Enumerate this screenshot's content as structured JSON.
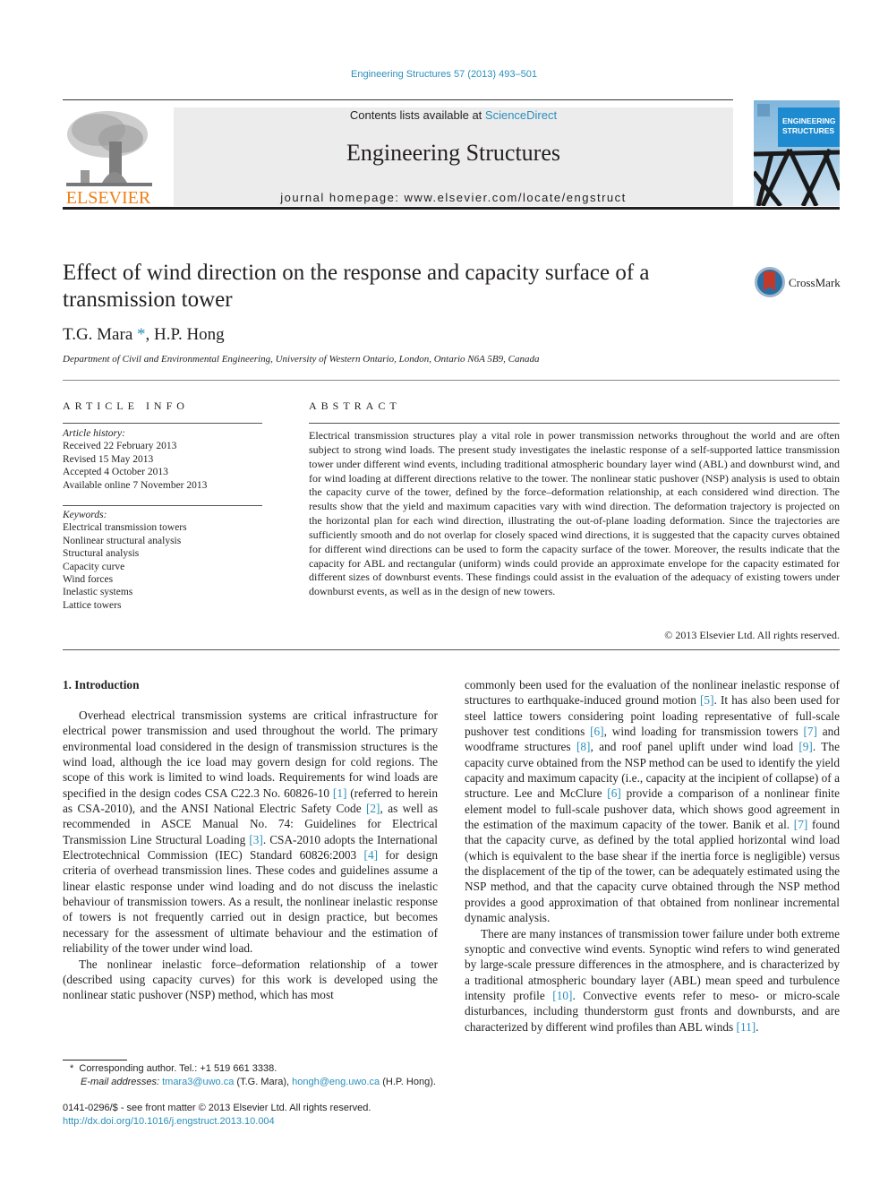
{
  "header": {
    "citation": "Engineering Structures 57 (2013) 493–501",
    "contents_prefix": "Contents lists available at ",
    "contents_link": "ScienceDirect",
    "journal_name": "Engineering Structures",
    "homepage_prefix": "journal homepage: ",
    "homepage_url": "www.elsevier.com/locate/engstruct",
    "publisher_logo_text": "ELSEVIER",
    "cover_title_line1": "ENGINEERING",
    "cover_title_line2": "STRUCTURES"
  },
  "article": {
    "title": "Effect of wind direction on the response and capacity surface of a transmission tower",
    "crossmark_label": "CrossMark",
    "authors": [
      {
        "name": "T.G. Mara",
        "mark": "*"
      },
      {
        "name": "H.P. Hong",
        "mark": ""
      }
    ],
    "author_separator": ", ",
    "affiliation": "Department of Civil and Environmental Engineering, University of Western Ontario, London, Ontario N6A 5B9, Canada"
  },
  "article_info": {
    "heading": "ARTICLE INFO",
    "history_label": "Article history:",
    "history": [
      "Received 22 February 2013",
      "Revised 15 May 2013",
      "Accepted 4 October 2013",
      "Available online 7 November 2013"
    ],
    "keywords_label": "Keywords:",
    "keywords": [
      "Electrical transmission towers",
      "Nonlinear structural analysis",
      "Structural analysis",
      "Capacity curve",
      "Wind forces",
      "Inelastic systems",
      "Lattice towers"
    ]
  },
  "abstract": {
    "heading": "ABSTRACT",
    "text": "Electrical transmission structures play a vital role in power transmission networks throughout the world and are often subject to strong wind loads. The present study investigates the inelastic response of a self-supported lattice transmission tower under different wind events, including traditional atmospheric boundary layer wind (ABL) and downburst wind, and for wind loading at different directions relative to the tower. The nonlinear static pushover (NSP) analysis is used to obtain the capacity curve of the tower, defined by the force–deformation relationship, at each considered wind direction. The results show that the yield and maximum capacities vary with wind direction. The deformation trajectory is projected on the horizontal plan for each wind direction, illustrating the out-of-plane loading deformation. Since the trajectories are sufficiently smooth and do not overlap for closely spaced wind directions, it is suggested that the capacity curves obtained for different wind directions can be used to form the capacity surface of the tower. Moreover, the results indicate that the capacity for ABL and rectangular (uniform) winds could provide an approximate envelope for the capacity estimated for different sizes of downburst events. These findings could assist in the evaluation of the adequacy of existing towers under downburst events, as well as in the design of new towers.",
    "copyright": "© 2013 Elsevier Ltd. All rights reserved."
  },
  "body": {
    "section_heading": "1. Introduction",
    "left_paragraphs": [
      [
        {
          "t": "Overhead electrical transmission systems are critical infrastructure for electrical power transmission and used throughout the world. The primary environmental load considered in the design of transmission structures is the wind load, although the ice load may govern design for cold regions. The scope of this work is limited to wind loads. Requirements for wind loads are specified in the design codes CSA C22.3 No. 60826-10 "
        },
        {
          "r": "[1]"
        },
        {
          "t": " (referred to herein as CSA-2010), and the ANSI National Electric Safety Code "
        },
        {
          "r": "[2]"
        },
        {
          "t": ", as well as recommended in ASCE Manual No. 74: Guidelines for Electrical Transmission Line Structural Loading "
        },
        {
          "r": "[3]"
        },
        {
          "t": ". CSA-2010 adopts the International Electrotechnical Commission (IEC) Standard 60826:2003 "
        },
        {
          "r": "[4]"
        },
        {
          "t": " for design criteria of overhead transmission lines. These codes and guidelines assume a linear elastic response under wind loading and do not discuss the inelastic behaviour of transmission towers. As a result, the nonlinear inelastic response of towers is not frequently carried out in design practice, but becomes necessary for the assessment of ultimate behaviour and the estimation of reliability of the tower under wind load."
        }
      ],
      [
        {
          "t": "The nonlinear inelastic force–deformation relationship of a tower (described using capacity curves) for this work is developed using the nonlinear static pushover (NSP) method, which has most"
        }
      ]
    ],
    "right_paragraphs": [
      [
        {
          "t": "commonly been used for the evaluation of the nonlinear inelastic response of structures to earthquake-induced ground motion "
        },
        {
          "r": "[5]"
        },
        {
          "t": ". It has also been used for steel lattice towers considering point loading representative of full-scale pushover test conditions "
        },
        {
          "r": "[6]"
        },
        {
          "t": ", wind loading for transmission towers "
        },
        {
          "r": "[7]"
        },
        {
          "t": " and woodframe structures "
        },
        {
          "r": "[8]"
        },
        {
          "t": ", and roof panel uplift under wind load "
        },
        {
          "r": "[9]"
        },
        {
          "t": ". The capacity curve obtained from the NSP method can be used to identify the yield capacity and maximum capacity (i.e., capacity at the incipient of collapse) of a structure. Lee and McClure "
        },
        {
          "r": "[6]"
        },
        {
          "t": " provide a comparison of a nonlinear finite element model to full-scale pushover data, which shows good agreement in the estimation of the maximum capacity of the tower. Banik et al. "
        },
        {
          "r": "[7]"
        },
        {
          "t": " found that the capacity curve, as defined by the total applied horizontal wind load (which is equivalent to the base shear if the inertia force is negligible) versus the displacement of the tip of the tower, can be adequately estimated using the NSP method, and that the capacity curve obtained through the NSP method provides a good approximation of that obtained from nonlinear incremental dynamic analysis."
        }
      ],
      [
        {
          "t": "There are many instances of transmission tower failure under both extreme synoptic and convective wind events. Synoptic wind refers to wind generated by large-scale pressure differences in the atmosphere, and is characterized by a traditional atmospheric boundary layer (ABL) mean speed and turbulence intensity profile "
        },
        {
          "r": "[10]"
        },
        {
          "t": ". Convective events refer to meso- or micro-scale disturbances, including thunderstorm gust fronts and downbursts, and are characterized by different wind profiles than ABL winds "
        },
        {
          "r": "[11]"
        },
        {
          "t": "."
        }
      ]
    ]
  },
  "footnotes": {
    "corresponding_mark": "*",
    "corresponding": "Corresponding author. Tel.: +1 519 661 3338.",
    "email_label": "E-mail addresses: ",
    "email1": "tmara3@uwo.ca",
    "email1_owner": " (T.G. Mara), ",
    "email2": "hongh@eng.uwo.ca",
    "email2_owner": " (H.P. Hong)."
  },
  "front_matter": {
    "issn_line": "0141-0296/$ - see front matter © 2013 Elsevier Ltd. All rights reserved.",
    "doi": "http://dx.doi.org/10.1016/j.engstruct.2013.10.004"
  },
  "colors": {
    "link": "#2a8fbd",
    "elsevier_orange": "#f07f15",
    "banner_gray": "#ececec"
  }
}
